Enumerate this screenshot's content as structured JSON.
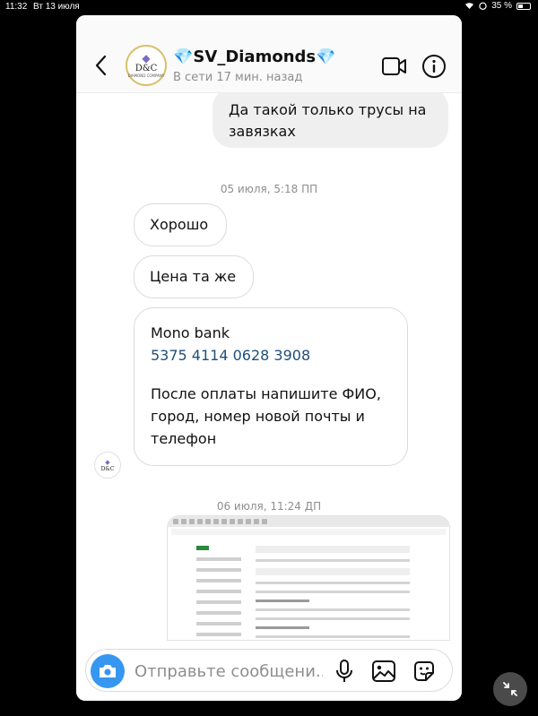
{
  "status_bar": {
    "time": "11:32",
    "date": "Вт 13 июля",
    "battery": "35 %"
  },
  "header": {
    "avatar_logo_text": "D&C",
    "avatar_logo_sub": "DIAMOND COMPANY",
    "name_prefix": "💎",
    "name": "SV_Diamonds",
    "name_suffix": "💎",
    "status": "В сети 17 мин. назад"
  },
  "messages": {
    "outgoing_1": "Да такой только трусы на завязках",
    "timestamp_1": "05 июля, 5:18 ПП",
    "incoming_1": "Хорошо",
    "incoming_2": "Цена та же",
    "incoming_3_line1": "Mono bank",
    "incoming_3_account": "5375 4114 0628 3908",
    "incoming_3_line2": "После оплаты напишите ФИО, город, номер новой почты и телефон",
    "timestamp_2": "06 июля, 11:24 ДП"
  },
  "composer": {
    "placeholder": "Отправьте сообщени..."
  },
  "colors": {
    "accent_blue": "#3797f0",
    "account_link": "#1f4f7a",
    "gem": "#3fa6e6"
  },
  "icons": {
    "back": "chevron-left-icon",
    "video": "video-camera-icon",
    "info": "info-icon",
    "camera": "camera-icon",
    "mic": "microphone-icon",
    "gallery": "gallery-icon",
    "sticker": "sticker-icon",
    "collapse": "collapse-icon"
  }
}
